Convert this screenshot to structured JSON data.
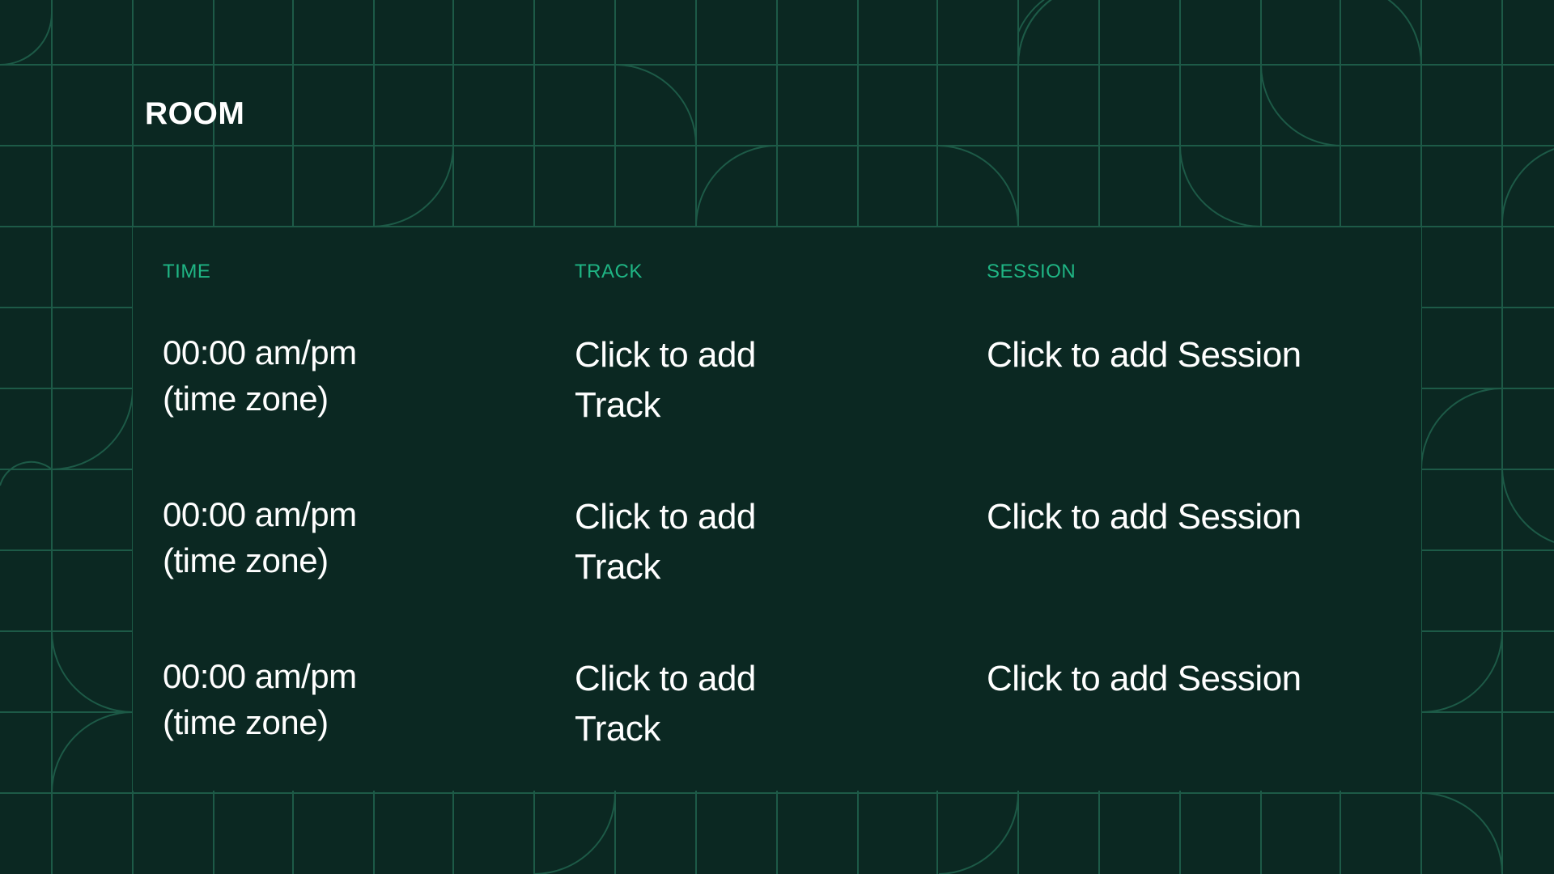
{
  "room_title": "ROOM",
  "columns": {
    "time": "TIME",
    "track": "TRACK",
    "session": "SESSION"
  },
  "rows": [
    {
      "time_line1": "00:00 am/pm",
      "time_line2": "(time zone)",
      "track_line1": "Click to add",
      "track_line2": "Track",
      "session": "Click to add Session"
    },
    {
      "time_line1": "00:00 am/pm",
      "time_line2": "(time zone)",
      "track_line1": "Click to add",
      "track_line2": "Track",
      "session": "Click to add Session"
    },
    {
      "time_line1": "00:00 am/pm",
      "time_line2": "(time zone)",
      "track_line1": "Click to add",
      "track_line2": "Track",
      "session": "Click to add Session"
    }
  ],
  "colors": {
    "background": "#0b2822",
    "grid_lines": "#1d5a47",
    "header_accent": "#1fb584",
    "text": "#ffffff"
  }
}
